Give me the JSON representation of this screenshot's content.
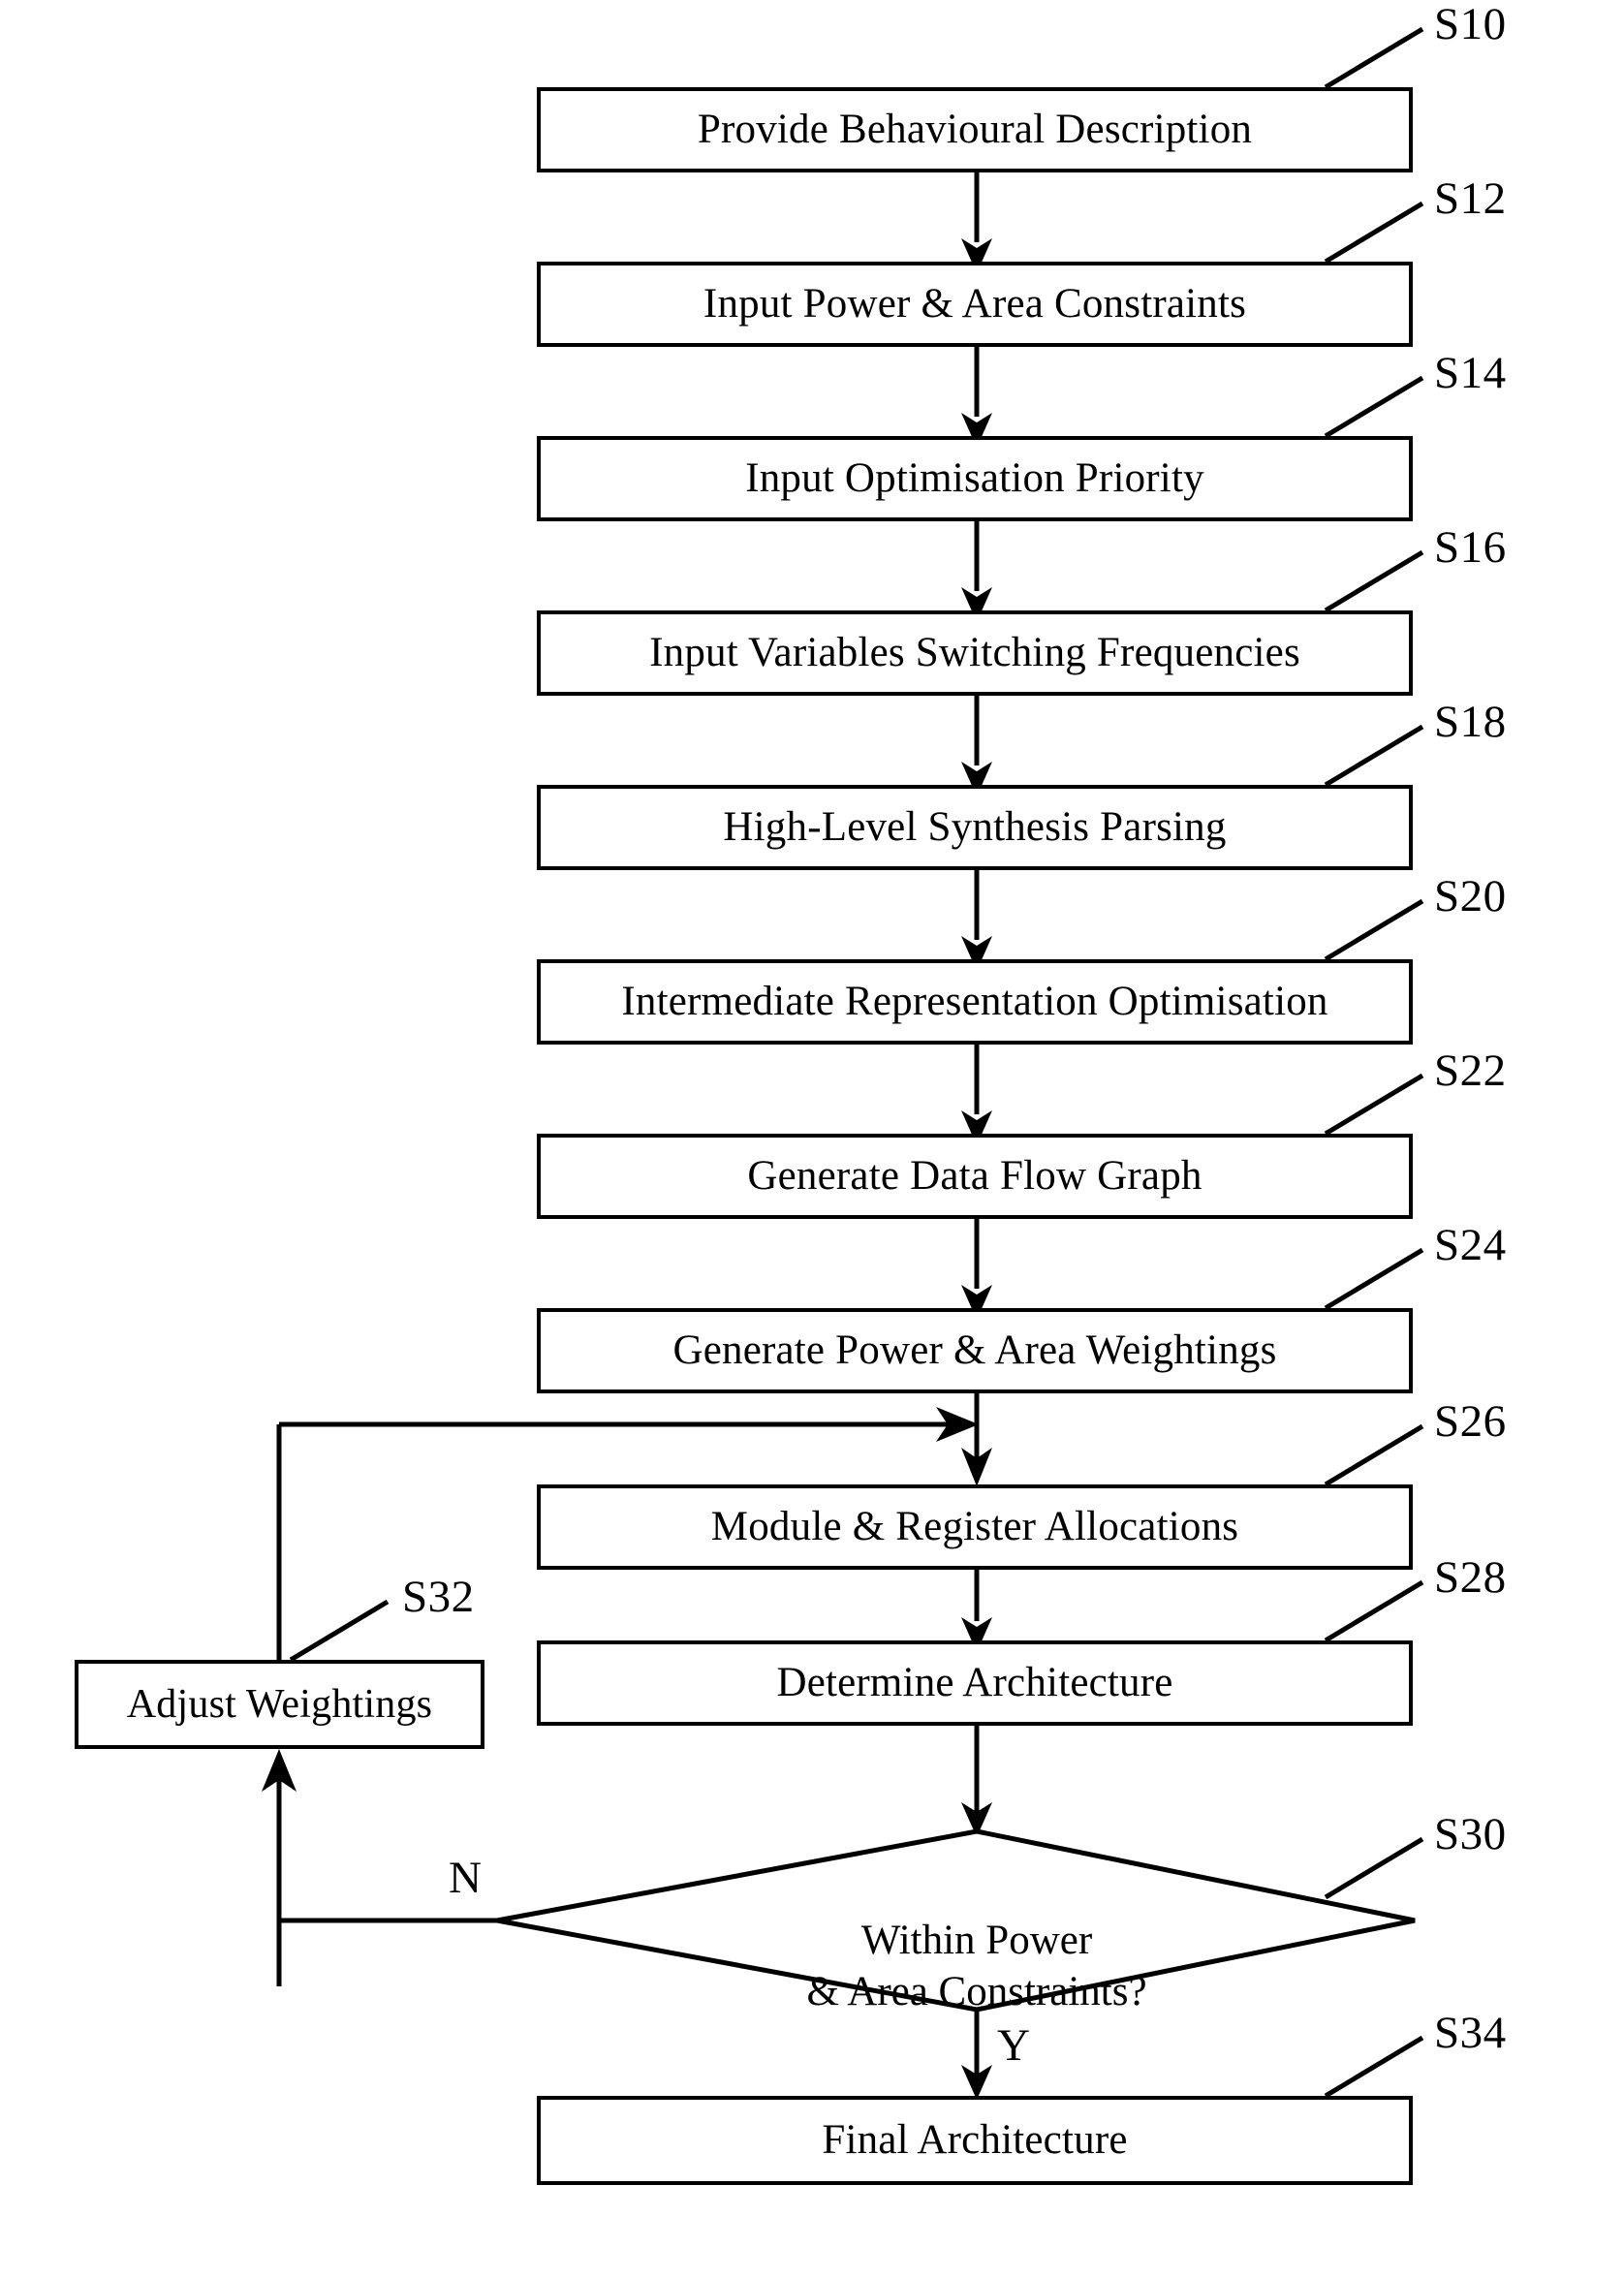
{
  "diagram": {
    "title": "High-Level Synthesis Flowchart",
    "stroke_color": "#000000",
    "background_color": "#ffffff",
    "nodes": [
      {
        "id": "S10",
        "shape": "process",
        "label": "Provide Behavioural Description",
        "step": "S10"
      },
      {
        "id": "S12",
        "shape": "process",
        "label": "Input Power & Area Constraints",
        "step": "S12"
      },
      {
        "id": "S14",
        "shape": "process",
        "label": "Input Optimisation Priority",
        "step": "S14"
      },
      {
        "id": "S16",
        "shape": "process",
        "label": "Input Variables Switching Frequencies",
        "step": "S16"
      },
      {
        "id": "S18",
        "shape": "process",
        "label": "High-Level Synthesis Parsing",
        "step": "S18"
      },
      {
        "id": "S20",
        "shape": "process",
        "label": "Intermediate Representation Optimisation",
        "step": "S20"
      },
      {
        "id": "S22",
        "shape": "process",
        "label": "Generate Data Flow Graph",
        "step": "S22"
      },
      {
        "id": "S24",
        "shape": "process",
        "label": "Generate Power & Area Weightings",
        "step": "S24"
      },
      {
        "id": "S26",
        "shape": "process",
        "label": "Module & Register Allocations",
        "step": "S26"
      },
      {
        "id": "S28",
        "shape": "process",
        "label": "Determine Architecture",
        "step": "S28"
      },
      {
        "id": "S30",
        "shape": "decision",
        "label": "Within Power\n& Area Constraints?",
        "step": "S30"
      },
      {
        "id": "S32",
        "shape": "process",
        "label": "Adjust Weightings",
        "step": "S32"
      },
      {
        "id": "S34",
        "shape": "process",
        "label": "Final Architecture",
        "step": "S34"
      }
    ],
    "branch_labels": [
      {
        "id": "no",
        "text": "N"
      },
      {
        "id": "yes",
        "text": "Y"
      }
    ],
    "step_labels": [
      "S10",
      "S12",
      "S14",
      "S16",
      "S18",
      "S20",
      "S22",
      "S24",
      "S26",
      "S28",
      "S30",
      "S32",
      "S34"
    ]
  }
}
